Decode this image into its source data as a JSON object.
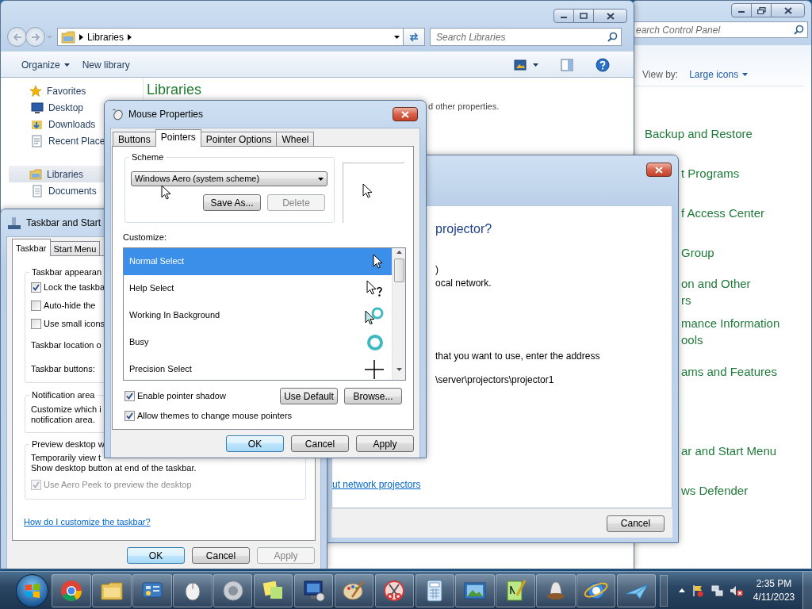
{
  "explorer": {
    "address": "Libraries",
    "search": {
      "placeholder": "Search Libraries"
    },
    "commands": [
      {
        "label": "Organize",
        "dropdown": true
      },
      {
        "label": "New library",
        "dropdown": false
      }
    ],
    "nav": [
      {
        "label": "Favorites",
        "kind": "star",
        "selected": false,
        "children": [
          {
            "label": "Desktop",
            "kind": "desktop",
            "selected": false
          },
          {
            "label": "Downloads",
            "kind": "downloads",
            "selected": false
          },
          {
            "label": "Recent Place",
            "kind": "recent",
            "selected": false
          }
        ]
      },
      {
        "label": "Libraries",
        "kind": "library",
        "selected": true,
        "children": [
          {
            "label": "Documents",
            "kind": "document",
            "selected": false
          }
        ]
      }
    ],
    "heading": "Libraries",
    "description": "d other properties."
  },
  "control_panel": {
    "search": {
      "placeholder": "earch Control Panel"
    },
    "view_by": {
      "label": "View by:",
      "value": "Large icons"
    },
    "items": [
      {
        "lines": [
          "Backup and Restore"
        ]
      },
      {
        "lines": [
          "t Programs"
        ]
      },
      {
        "lines": [
          "f Access Center"
        ]
      },
      {
        "lines": [
          "Group"
        ]
      },
      {
        "lines": [
          "on and Other",
          "rs"
        ]
      },
      {
        "lines": [
          "mance Information",
          "ools"
        ]
      },
      {
        "lines": [
          "ams and Features"
        ]
      },
      {
        "lines": [
          "ar and Start Menu"
        ]
      },
      {
        "lines": [
          "ws Defender"
        ]
      }
    ]
  },
  "projector_dialog": {
    "lines": [
      {
        "kind": "heading",
        "text": "projector?"
      },
      {
        "kind": "text",
        "text": ")"
      },
      {
        "kind": "text",
        "text": "ocal network."
      },
      {
        "kind": "text",
        "text": "that you want to use, enter the address"
      },
      {
        "kind": "text",
        "text": "\\server\\projectors\\projector1"
      }
    ],
    "link": "ut network projectors",
    "buttons": [
      {
        "label": "Cancel",
        "default": false,
        "disabled": false
      }
    ]
  },
  "taskbar_dialog": {
    "title": "Taskbar and Start",
    "tabs": [
      {
        "label": "Taskbar",
        "selected": true
      },
      {
        "label": "Start Menu",
        "selected": false
      }
    ],
    "groups": [
      {
        "legend": "Taskbar appearan",
        "rows": [
          {
            "kind": "checkbox",
            "label": "Lock the taskba",
            "checked": true,
            "disabled": false
          },
          {
            "kind": "checkbox",
            "label": "Auto-hide the",
            "checked": false,
            "disabled": false
          },
          {
            "kind": "checkbox",
            "label": "Use small icons",
            "checked": false,
            "disabled": false
          },
          {
            "kind": "text",
            "lines": [
              "Taskbar location o"
            ]
          },
          {
            "kind": "text",
            "lines": [
              "Taskbar buttons:"
            ]
          }
        ]
      },
      {
        "legend": "Notification area",
        "rows": [
          {
            "kind": "paragraph",
            "lines": [
              "Customize which i",
              "notification area."
            ]
          }
        ]
      },
      {
        "legend": "Preview desktop w",
        "rows": [
          {
            "kind": "paragraph",
            "lines": [
              "Temporarily view t",
              "Show desktop button at end of the taskbar."
            ]
          },
          {
            "kind": "checkbox",
            "label": "Use Aero Peek to preview the desktop",
            "checked": true,
            "disabled": true
          }
        ]
      }
    ],
    "help_link": "How do I customize the taskbar?",
    "buttons": [
      {
        "label": "OK",
        "default": true,
        "disabled": false
      },
      {
        "label": "Cancel",
        "default": false,
        "disabled": false
      },
      {
        "label": "Apply",
        "default": false,
        "disabled": true
      }
    ]
  },
  "mouse_dialog": {
    "title": "Mouse Properties",
    "tabs": [
      {
        "label": "Buttons",
        "selected": false
      },
      {
        "label": "Pointers",
        "selected": true
      },
      {
        "label": "Pointer Options",
        "selected": false
      },
      {
        "label": "Wheel",
        "selected": false
      }
    ],
    "scheme": {
      "legend": "Scheme",
      "value": "Windows Aero (system scheme)",
      "buttons": [
        {
          "label": "Save As...",
          "default": false,
          "disabled": false
        },
        {
          "label": "Delete",
          "default": false,
          "disabled": true
        }
      ]
    },
    "customize_label": "Customize:",
    "pointers": [
      {
        "label": "Normal Select",
        "kind": "arrow",
        "selected": true
      },
      {
        "label": "Help Select",
        "kind": "help",
        "selected": false
      },
      {
        "label": "Working In Background",
        "kind": "working",
        "selected": false
      },
      {
        "label": "Busy",
        "kind": "busy",
        "selected": false
      },
      {
        "label": "Precision Select",
        "kind": "cross",
        "selected": false
      }
    ],
    "options": [
      {
        "label": "Enable pointer shadow",
        "checked": true
      },
      {
        "label": "Allow themes to change mouse pointers",
        "checked": true
      }
    ],
    "side_buttons": [
      {
        "label": "Use Default",
        "default": false,
        "disabled": false
      },
      {
        "label": "Browse...",
        "default": false,
        "disabled": false
      }
    ],
    "buttons": [
      {
        "label": "OK",
        "default": true,
        "disabled": false
      },
      {
        "label": "Cancel",
        "default": false,
        "disabled": false
      },
      {
        "label": "Apply",
        "default": false,
        "disabled": false
      }
    ]
  },
  "taskbar": {
    "apps": [
      {
        "kind": "chrome"
      },
      {
        "kind": "folder"
      },
      {
        "kind": "panel"
      },
      {
        "kind": "mouse"
      },
      {
        "kind": "speaker"
      },
      {
        "kind": "notes"
      },
      {
        "kind": "monitor"
      },
      {
        "kind": "palette"
      },
      {
        "kind": "scissors"
      },
      {
        "kind": "calculator"
      },
      {
        "kind": "photo"
      },
      {
        "kind": "pen"
      },
      {
        "kind": "bell"
      },
      {
        "kind": "ie"
      },
      {
        "kind": "plane"
      }
    ],
    "clock": {
      "time": "2:35 PM",
      "date": "4/11/2023"
    }
  }
}
